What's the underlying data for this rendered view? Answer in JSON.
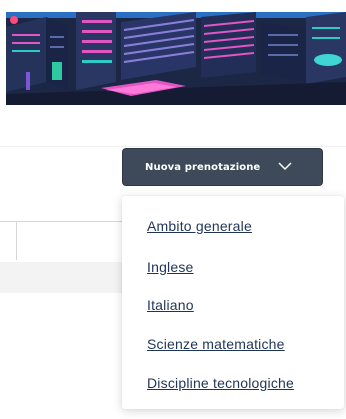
{
  "toolbar": {
    "new_booking_label": "Nuova prenotazione",
    "new_booking_icon": "chevron-down-icon"
  },
  "dropdown": {
    "items": [
      {
        "label": "Ambito generale"
      },
      {
        "label": "Inglese"
      },
      {
        "label": "Italiano"
      },
      {
        "label": "Scienze matematiche"
      },
      {
        "label": "Discipline tecnologiche"
      }
    ]
  },
  "colors": {
    "button_bg": "#3e4a59",
    "link": "#1f3556",
    "hero_dark": "#1a2340",
    "hero_accent_pink": "#e255c4",
    "hero_accent_teal": "#2ec9c9"
  }
}
